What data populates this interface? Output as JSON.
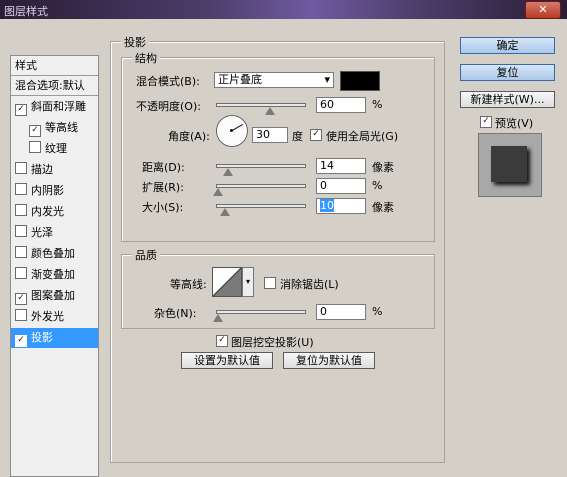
{
  "window": {
    "title": "图层样式",
    "close": "✕"
  },
  "styles_list": {
    "header": "样式",
    "items": [
      {
        "label": "混合选项:默认",
        "checkbox": false,
        "checked": false,
        "selected": false,
        "indent": false
      },
      {
        "label": "斜面和浮雕",
        "checkbox": true,
        "checked": true,
        "selected": false,
        "indent": false
      },
      {
        "label": "等高线",
        "checkbox": true,
        "checked": true,
        "selected": false,
        "indent": true
      },
      {
        "label": "纹理",
        "checkbox": true,
        "checked": false,
        "selected": false,
        "indent": true
      },
      {
        "label": "描边",
        "checkbox": true,
        "checked": false,
        "selected": false,
        "indent": false
      },
      {
        "label": "内阴影",
        "checkbox": true,
        "checked": false,
        "selected": false,
        "indent": false
      },
      {
        "label": "内发光",
        "checkbox": true,
        "checked": false,
        "selected": false,
        "indent": false
      },
      {
        "label": "光泽",
        "checkbox": true,
        "checked": false,
        "selected": false,
        "indent": false
      },
      {
        "label": "颜色叠加",
        "checkbox": true,
        "checked": false,
        "selected": false,
        "indent": false
      },
      {
        "label": "渐变叠加",
        "checkbox": true,
        "checked": false,
        "selected": false,
        "indent": false
      },
      {
        "label": "图案叠加",
        "checkbox": true,
        "checked": true,
        "selected": false,
        "indent": false
      },
      {
        "label": "外发光",
        "checkbox": true,
        "checked": false,
        "selected": false,
        "indent": false
      },
      {
        "label": "投影",
        "checkbox": true,
        "checked": true,
        "selected": true,
        "indent": false
      }
    ]
  },
  "panel": {
    "title": "投影",
    "structure": {
      "title": "结构",
      "blend_mode_label": "混合模式(B):",
      "blend_mode_value": "正片叠底",
      "blend_color": "#000000",
      "opacity_label": "不透明度(O):",
      "opacity_value": "60",
      "opacity_percent": 60,
      "opacity_unit": "%",
      "angle_label": "角度(A):",
      "angle_value": "30",
      "angle_unit": "度",
      "global_light_label": "使用全局光(G)",
      "global_light_checked": true,
      "distance_label": "距离(D):",
      "distance_value": "14",
      "distance_unit": "像素",
      "spread_label": "扩展(R):",
      "spread_value": "0",
      "spread_percent": 0,
      "spread_unit": "%",
      "size_label": "大小(S):",
      "size_value": "10",
      "size_unit": "像素"
    },
    "quality": {
      "title": "品质",
      "contour_label": "等高线:",
      "antialias_label": "消除锯齿(L)",
      "antialias_checked": false,
      "noise_label": "杂色(N):",
      "noise_value": "0",
      "noise_percent": 0,
      "noise_unit": "%"
    },
    "knockout_label": "图层挖空投影(U)",
    "knockout_checked": true,
    "make_default": "设置为默认值",
    "reset_default": "复位为默认值"
  },
  "buttons": {
    "ok": "确定",
    "reset": "复位",
    "new_style": "新建样式(W)...",
    "preview_label": "预览(V)",
    "preview_checked": true
  },
  "colors": {
    "selected": "#3399ff",
    "ok_button": "#aac8ea"
  }
}
